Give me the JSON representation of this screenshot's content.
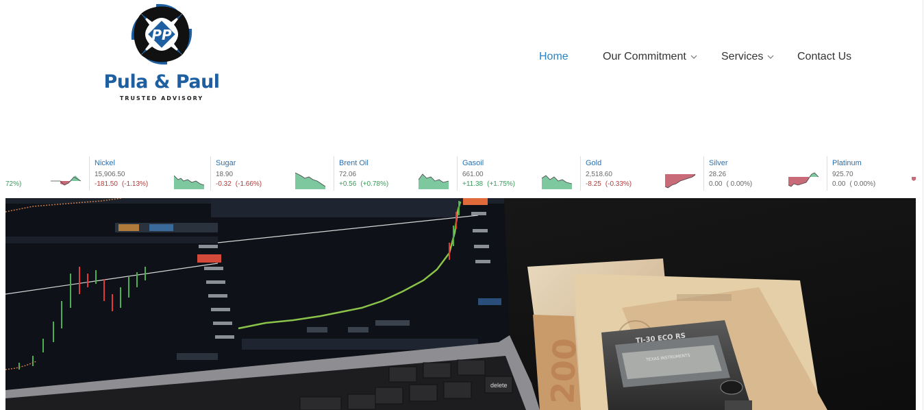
{
  "brand": {
    "name": "Pula & Paul",
    "tagline": "TRUSTED ADVISORY",
    "monogram": "PP",
    "colors": {
      "primary": "#1d5fa0",
      "dark": "#111111"
    }
  },
  "nav": {
    "items": [
      {
        "label": "Home",
        "active": true,
        "has_dropdown": false
      },
      {
        "label": "Our Commitment",
        "active": false,
        "has_dropdown": true
      },
      {
        "label": "Services",
        "active": false,
        "has_dropdown": true
      },
      {
        "label": "Contact Us",
        "active": false,
        "has_dropdown": false
      }
    ],
    "active_color": "#2a83c9"
  },
  "ticker": {
    "partial_first_pct": "72%)",
    "items": [
      {
        "name": "Nickel",
        "price": "15,906.50",
        "change": "-181.50",
        "change_pct": "(-1.13%)",
        "direction": "down"
      },
      {
        "name": "Sugar",
        "price": "18.90",
        "change": "-0.32",
        "change_pct": "(-1.66%)",
        "direction": "down"
      },
      {
        "name": "Brent Oil",
        "price": "72.06",
        "change": "+0.56",
        "change_pct": "(+0.78%)",
        "direction": "up"
      },
      {
        "name": "Gasoil",
        "price": "661.00",
        "change": "+11.38",
        "change_pct": "(+1.75%)",
        "direction": "up"
      },
      {
        "name": "Gold",
        "price": "2,518.60",
        "change": "-8.25",
        "change_pct": "(-0.33%)",
        "direction": "down"
      },
      {
        "name": "Silver",
        "price": "28.26",
        "change": "0.00",
        "change_pct": "( 0.00%)",
        "direction": "flat"
      },
      {
        "name": "Platinum",
        "price": "925.70",
        "change": "0.00",
        "change_pct": "( 0.00%)",
        "direction": "flat"
      }
    ],
    "colors": {
      "up": "#3a9a5b",
      "down": "#b03a3a",
      "flat": "#666666",
      "name": "#2a6fb0"
    }
  },
  "hero": {
    "subject": "laptop with stock chart, euro banknotes and calculator",
    "calculator_brand": "TEXAS INSTRUMENTS",
    "calculator_model": "TI-30 ECO RS",
    "laptop_key_label": "delete"
  }
}
